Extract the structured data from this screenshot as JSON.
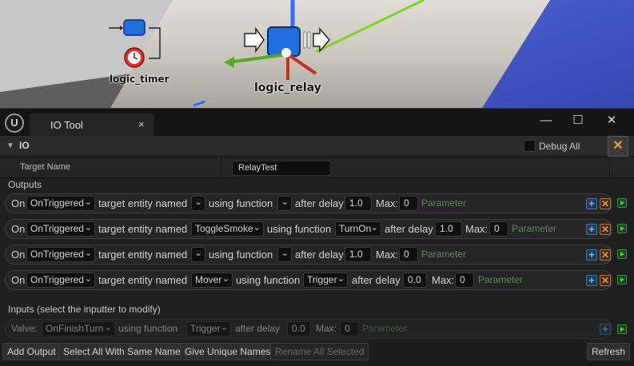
{
  "viewport": {
    "entities": [
      {
        "name": "logic_timer"
      },
      {
        "name": "logic_relay"
      }
    ]
  },
  "window": {
    "tab_title": "IO Tool",
    "tab_close": "×",
    "min_glyph": "—",
    "max_glyph": "☐",
    "close_glyph": "✕"
  },
  "io": {
    "header": "IO",
    "debug_all_label": "Debug All",
    "debug_all_checked": false,
    "clear_glyph": "✕",
    "target_name_label": "Target Name",
    "target_name_value": "RelayTest",
    "outputs_label": "Outputs",
    "inputs_label": "Inputs (select the inputter to modify)"
  },
  "words": {
    "on": "On",
    "target_entity_named": "target entity named",
    "using_function": "using function",
    "after_delay": "after delay",
    "max": "Max:",
    "parameter": "Parameter",
    "valve": "Valve:"
  },
  "outputs": [
    {
      "event": "OnTriggered",
      "target": "",
      "function": "",
      "delay": "1.0",
      "max": "0",
      "parameter": "Parameter"
    },
    {
      "event": "OnTriggered",
      "target": "ToggleSmoke",
      "function": "TurnOn",
      "delay": "1.0",
      "max": "0",
      "parameter": "Parameter"
    },
    {
      "event": "OnTriggered",
      "target": "",
      "function": "",
      "delay": "1.0",
      "max": "0",
      "parameter": "Parameter"
    },
    {
      "event": "OnTriggered",
      "target": "Mover",
      "function": "Trigger",
      "delay": "0.0",
      "max": "0",
      "parameter": "Parameter"
    }
  ],
  "inputs": [
    {
      "event": "OnFinishTurn",
      "function": "Trigger",
      "delay": "0.0",
      "max": "0",
      "parameter": "Parameter"
    }
  ],
  "buttons": {
    "add_output": "Add Output",
    "select_all_same_name": "Select All With Same Name",
    "give_unique_names": "Give Unique Names",
    "rename_all_selected": "Rename All Selected",
    "refresh": "Refresh"
  },
  "colors": {
    "accent_orange": "#e89a30",
    "accent_green": "#47d047",
    "accent_blue": "#3e7ab0"
  }
}
